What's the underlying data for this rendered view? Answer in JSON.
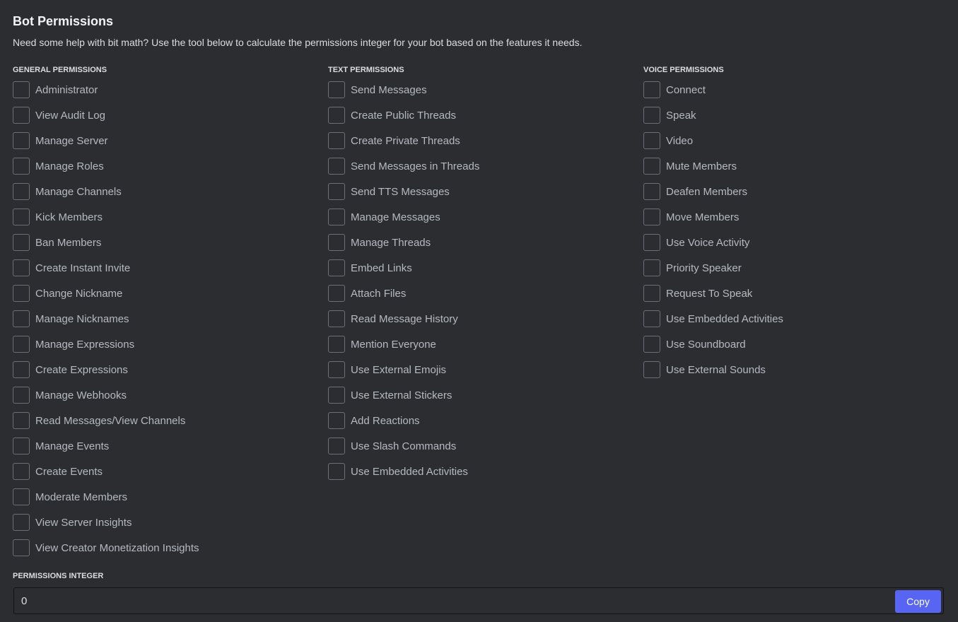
{
  "title": "Bot Permissions",
  "subtitle": "Need some help with bit math? Use the tool below to calculate the permissions integer for your bot based on the features it needs.",
  "columns": [
    {
      "heading": "GENERAL PERMISSIONS",
      "items": [
        "Administrator",
        "View Audit Log",
        "Manage Server",
        "Manage Roles",
        "Manage Channels",
        "Kick Members",
        "Ban Members",
        "Create Instant Invite",
        "Change Nickname",
        "Manage Nicknames",
        "Manage Expressions",
        "Create Expressions",
        "Manage Webhooks",
        "Read Messages/View Channels",
        "Manage Events",
        "Create Events",
        "Moderate Members",
        "View Server Insights",
        "View Creator Monetization Insights"
      ]
    },
    {
      "heading": "TEXT PERMISSIONS",
      "items": [
        "Send Messages",
        "Create Public Threads",
        "Create Private Threads",
        "Send Messages in Threads",
        "Send TTS Messages",
        "Manage Messages",
        "Manage Threads",
        "Embed Links",
        "Attach Files",
        "Read Message History",
        "Mention Everyone",
        "Use External Emojis",
        "Use External Stickers",
        "Add Reactions",
        "Use Slash Commands",
        "Use Embedded Activities"
      ]
    },
    {
      "heading": "VOICE PERMISSIONS",
      "items": [
        "Connect",
        "Speak",
        "Video",
        "Mute Members",
        "Deafen Members",
        "Move Members",
        "Use Voice Activity",
        "Priority Speaker",
        "Request To Speak",
        "Use Embedded Activities",
        "Use Soundboard",
        "Use External Sounds"
      ]
    }
  ],
  "permissions_integer": {
    "label": "PERMISSIONS INTEGER",
    "value": "0",
    "copy_label": "Copy"
  },
  "colors": {
    "background": "#2b2d31",
    "accent": "#5865f2"
  }
}
